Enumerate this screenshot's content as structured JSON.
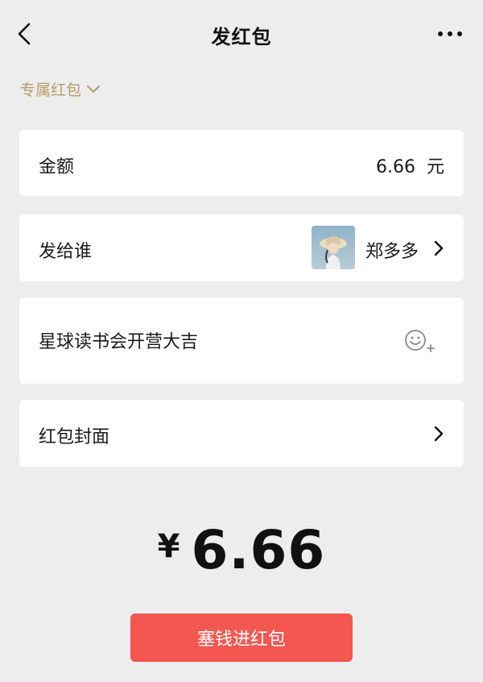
{
  "header": {
    "title": "发红包",
    "back_icon": "chevron-left-icon",
    "more_icon": "more-dots-icon"
  },
  "packet_type": {
    "label": "专属红包",
    "icon": "chevron-down-icon",
    "color": "#b89a68"
  },
  "amount": {
    "label": "金额",
    "value": "6.66",
    "unit": "元"
  },
  "recipient": {
    "label": "发给谁",
    "name": "郑多多",
    "avatar_icon": "user-avatar"
  },
  "message": {
    "value": "星球读书会开营大吉",
    "emoji_icon": "add-emoji-icon"
  },
  "cover": {
    "label": "红包封面"
  },
  "total": {
    "currency": "¥",
    "value": "6.66"
  },
  "send_button": {
    "label": "塞钱进红包",
    "color": "#f4574f"
  },
  "colors": {
    "background": "#ededed",
    "card": "#ffffff"
  }
}
